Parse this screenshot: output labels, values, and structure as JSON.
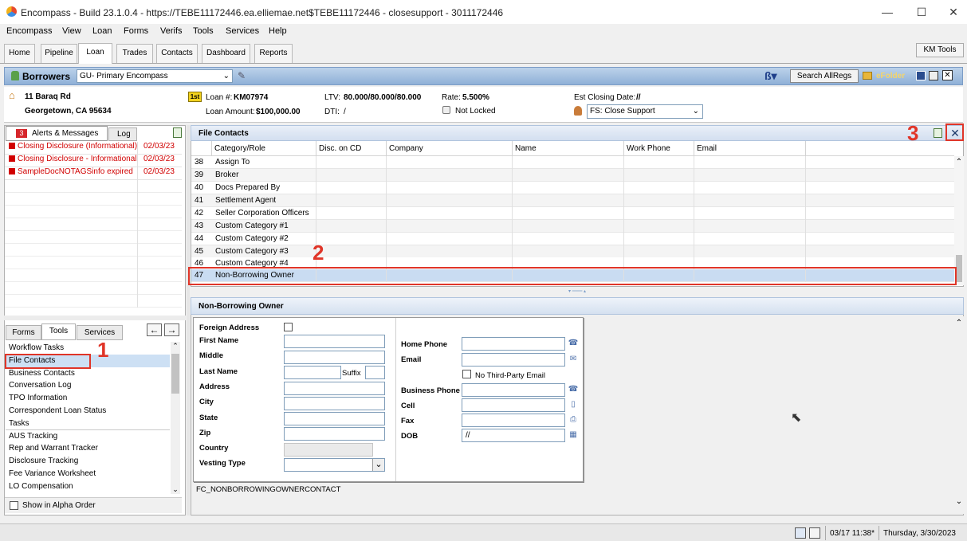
{
  "window": {
    "title": "Encompass - Build 23.1.0.4 - https://TEBE11172446.ea.elliemae.net$TEBE11172446 - closesupport - 3011172446",
    "minimize": "—",
    "maximize": "☐",
    "close": "✕"
  },
  "menu": [
    "Encompass",
    "View",
    "Loan",
    "Forms",
    "Verifs",
    "Tools",
    "Services",
    "Help"
  ],
  "tabs": [
    "Home",
    "Pipeline",
    "Loan",
    "Trades",
    "Contacts",
    "Dashboard",
    "Reports"
  ],
  "km_tools": "KM Tools",
  "borrower_bar": {
    "label": "Borrowers",
    "dropdown": "GU- Primary Encompass",
    "search_button": "Search AllRegs",
    "efolder": "eFolder"
  },
  "loan": {
    "address1": "11 Baraq Rd",
    "address2": "Georgetown, CA 95634",
    "lien_badge": "1st",
    "loan_number_label": "Loan #:",
    "loan_number": "KM07974",
    "loan_amount_label": "Loan Amount:",
    "loan_amount": "$100,000.00",
    "ltv_label": "LTV:",
    "ltv": "80.000/80.000/80.000",
    "dti_label": "DTI:",
    "dti": "/",
    "rate_label": "Rate:",
    "rate": "5.500%",
    "lock_status": "Not Locked",
    "closing_label": "Est Closing Date:",
    "closing": "//",
    "fs_dropdown": "FS: Close Support"
  },
  "alerts": {
    "count": "3",
    "tab_label": "Alerts & Messages",
    "log_tab": "Log",
    "items": [
      {
        "text": "Closing Disclosure (Informational)",
        "date": "02/03/23"
      },
      {
        "text": "Closing Disclosure - Informational",
        "date": "02/03/23"
      },
      {
        "text": "SampleDocNOTAGSinfo expired",
        "date": "02/03/23"
      }
    ]
  },
  "left_tabs": {
    "forms": "Forms",
    "tools": "Tools",
    "services": "Services"
  },
  "tools_list": [
    "Workflow Tasks",
    "File Contacts",
    "Business Contacts",
    "Conversation Log",
    "TPO Information",
    "Correspondent Loan Status",
    "Tasks",
    "AUS Tracking",
    "Rep and Warrant Tracker",
    "Disclosure Tracking",
    "Fee Variance Worksheet",
    "LO Compensation"
  ],
  "show_alpha": "Show in Alpha Order",
  "file_contacts": {
    "title": "File Contacts",
    "columns": [
      "Category/Role",
      "Disc. on CD",
      "Company",
      "Name",
      "Work Phone",
      "Email"
    ],
    "rows": [
      {
        "num": "38",
        "role": "Assign To"
      },
      {
        "num": "39",
        "role": "Broker"
      },
      {
        "num": "40",
        "role": "Docs Prepared By"
      },
      {
        "num": "41",
        "role": "Settlement Agent"
      },
      {
        "num": "42",
        "role": "Seller Corporation Officers"
      },
      {
        "num": "43",
        "role": "Custom Category #1"
      },
      {
        "num": "44",
        "role": "Custom Category #2"
      },
      {
        "num": "45",
        "role": "Custom Category #3"
      },
      {
        "num": "46",
        "role": "Custom Category #4"
      },
      {
        "num": "47",
        "role": "Non-Borrowing Owner"
      }
    ]
  },
  "nbo": {
    "title": "Non-Borrowing Owner",
    "foreign_address": "Foreign Address",
    "first_name": "First Name",
    "middle": "Middle",
    "last_name": "Last Name",
    "suffix": "Suffix",
    "address": "Address",
    "city": "City",
    "state": "State",
    "zip": "Zip",
    "country": "Country",
    "vesting_type": "Vesting Type",
    "home_phone": "Home Phone",
    "email": "Email",
    "no_third_party_email": "No Third-Party Email",
    "business_phone": "Business Phone",
    "cell": "Cell",
    "fax": "Fax",
    "dob": "DOB",
    "dob_value": "//",
    "form_id": "FC_NONBORROWINGOWNERCONTACT"
  },
  "annotations": {
    "a1": "1",
    "a2": "2",
    "a3": "3"
  },
  "status": {
    "datetime": "03/17 11:38*",
    "day": "Thursday, 3/30/2023"
  }
}
